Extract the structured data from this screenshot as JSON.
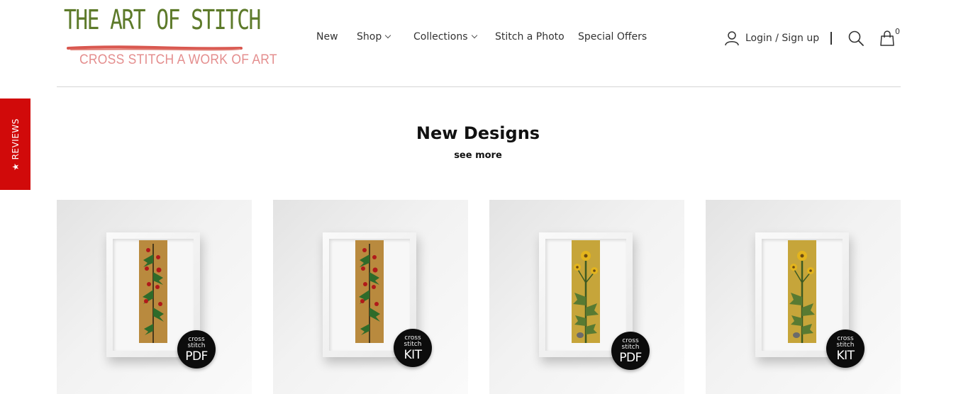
{
  "brand": {
    "title": "THE ART OF STITCH",
    "tagline": "CROSS STITCH A WORK OF ART",
    "colors": {
      "title": "#5d7a2a",
      "stroke": "#d9574f",
      "tagline": "#e48e8e"
    }
  },
  "nav": {
    "items": [
      {
        "label": "New",
        "dropdown": false
      },
      {
        "label": "Shop",
        "dropdown": true
      },
      {
        "label": "Collections",
        "dropdown": true
      },
      {
        "label": "Stitch a Photo",
        "dropdown": false
      },
      {
        "label": "Special Offers",
        "dropdown": false
      }
    ]
  },
  "header": {
    "account_label": "Login / Sign up",
    "account_icon": "user-icon",
    "search_icon": "search-icon",
    "cart_icon": "shopping-bag-icon",
    "cart_count": "0"
  },
  "reviews_tab": {
    "label": "★ REVIEWS",
    "color": "#d10a0a"
  },
  "section": {
    "title": "New Designs",
    "see_more": "see more"
  },
  "products": [
    {
      "design": "holly",
      "badge_small_1": "cross",
      "badge_small_2": "stitch",
      "badge_type": "PDF"
    },
    {
      "design": "holly",
      "badge_small_1": "cross",
      "badge_small_2": "stitch",
      "badge_type": "KIT"
    },
    {
      "design": "sunflower",
      "badge_small_1": "cross",
      "badge_small_2": "stitch",
      "badge_type": "PDF"
    },
    {
      "design": "sunflower",
      "badge_small_1": "cross",
      "badge_small_2": "stitch",
      "badge_type": "KIT"
    }
  ]
}
